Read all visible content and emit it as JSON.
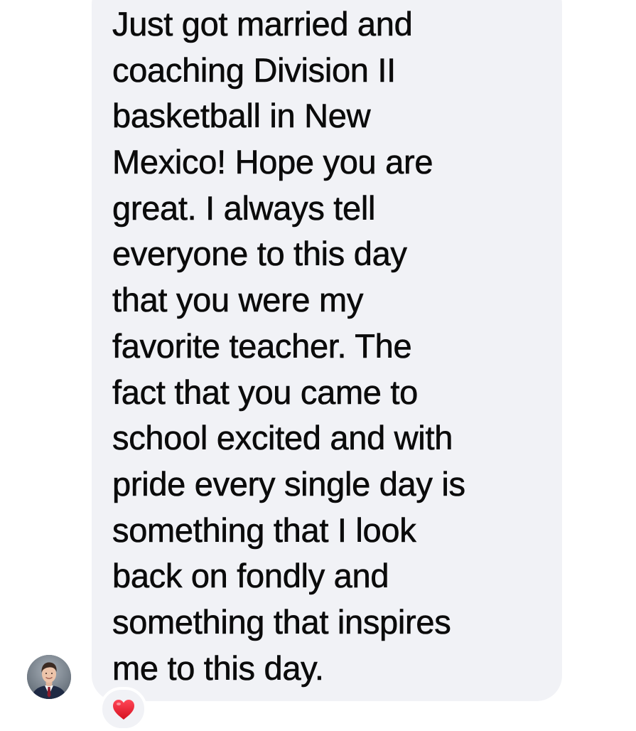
{
  "conversation": {
    "message": {
      "lines": [
        "Just got married and",
        "coaching Division II",
        "basketball in New",
        "Mexico! Hope you are",
        "great. I always tell",
        "everyone to this day",
        "that you were my",
        "favorite teacher. The",
        "fact that you came to",
        "school excited and with",
        "pride every single day is",
        "something that I look",
        "back on fondly and",
        "something that inspires",
        "me to this day."
      ],
      "reaction": "heart-icon",
      "bubble_color": "#f1f2f6",
      "reaction_color": "#e0202f"
    },
    "sender": {
      "avatar": "person-avatar"
    }
  }
}
